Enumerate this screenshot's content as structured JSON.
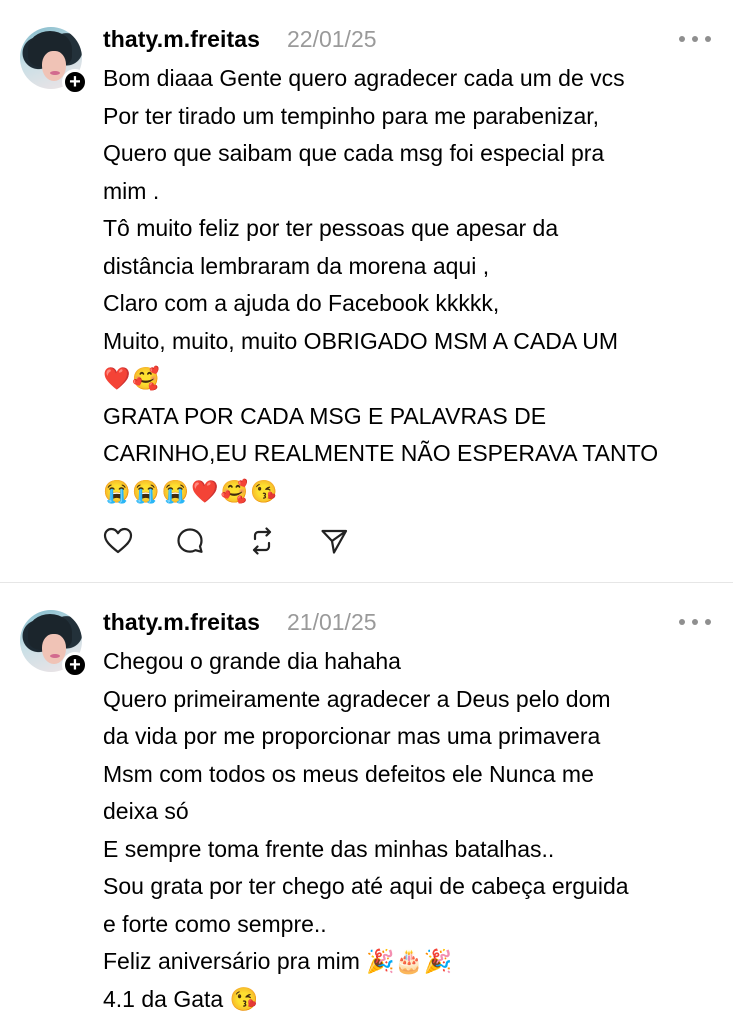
{
  "posts": [
    {
      "username": "thaty.m.freitas",
      "timestamp": "22/01/25",
      "lines": [
        "Bom diaaa Gente quero agradecer cada um de vcs",
        "Por ter tirado um tempinho para me parabenizar,",
        "Quero que saibam que cada msg foi especial pra",
        "mim .",
        "Tô muito feliz por ter pessoas que apesar da",
        "distância lembraram da morena aqui ,",
        "Claro com a ajuda do Facebook kkkkk,",
        "Muito, muito, muito OBRIGADO MSM A CADA UM",
        "❤️🥰",
        "GRATA POR CADA MSG E PALAVRAS DE",
        "CARINHO,EU REALMENTE NÃO ESPERAVA TANTO",
        "😭😭😭❤️🥰😘"
      ],
      "actions": [
        "heart-icon",
        "comment-icon",
        "repost-icon",
        "share-icon"
      ]
    },
    {
      "username": "thaty.m.freitas",
      "timestamp": "21/01/25",
      "lines": [
        "Chegou o grande dia hahaha",
        "Quero primeiramente agradecer a Deus pelo dom",
        "da vida por me proporcionar mas uma primavera",
        "Msm com todos os meus defeitos ele Nunca me",
        "deixa só",
        "E sempre toma frente das minhas batalhas..",
        "Sou grata por ter chego até aqui de cabeça erguida",
        "e forte como sempre..",
        "Feliz aniversário pra mim 🎉🎂🎉",
        "4.1 da Gata 😘"
      ]
    }
  ],
  "follow_badge": "+"
}
